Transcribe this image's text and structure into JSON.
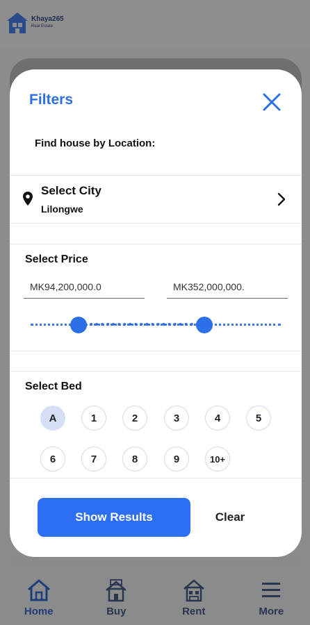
{
  "app": {
    "logo_name": "Khaya265",
    "logo_sub": "Real Estate"
  },
  "filters": {
    "title": "Filters",
    "find_by_location": "Find house by Location:",
    "city": {
      "label": "Select City",
      "value": "Lilongwe"
    },
    "price": {
      "title": "Select Price",
      "min_value": "MK94,200,000.0",
      "max_value": "MK352,000,000."
    },
    "beds": {
      "title": "Select Bed",
      "options": [
        "A",
        "1",
        "2",
        "3",
        "4",
        "5",
        "6",
        "7",
        "8",
        "9",
        "10+"
      ],
      "selected": "A"
    },
    "show_results_label": "Show Results",
    "clear_label": "Clear"
  },
  "bottom_nav": {
    "items": [
      {
        "label": "Home",
        "icon": "home-icon",
        "active": true
      },
      {
        "label": "Buy",
        "icon": "buy-house-icon",
        "active": false
      },
      {
        "label": "Rent",
        "icon": "rent-house-icon",
        "active": false
      },
      {
        "label": "More",
        "icon": "menu-icon",
        "active": false
      }
    ]
  },
  "colors": {
    "accent": "#2d6fe6",
    "button": "#2c6ff5",
    "selected_chip": "#d5dff5"
  }
}
